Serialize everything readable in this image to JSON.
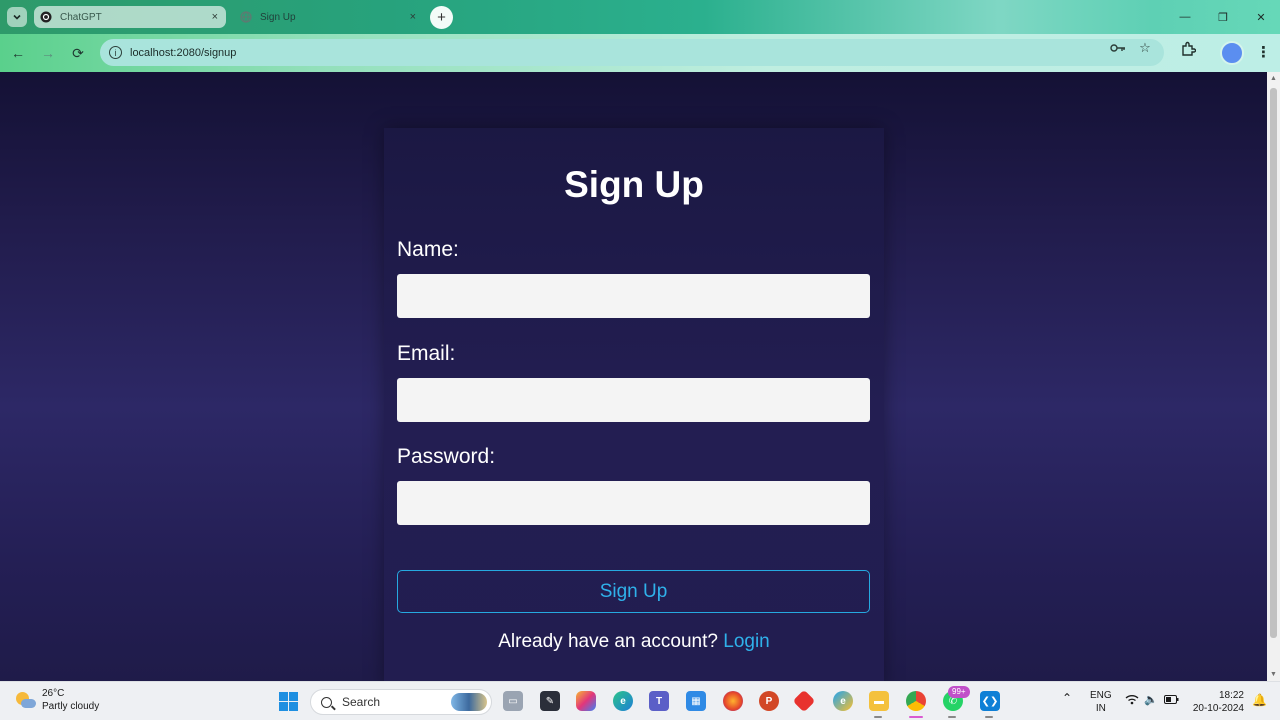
{
  "browser": {
    "tabs": [
      {
        "title": "ChatGPT",
        "close": "×",
        "active": false
      },
      {
        "title": "Sign Up",
        "close": "×",
        "active": true
      }
    ],
    "new_tab": "+",
    "url": "localhost:2080/signup",
    "window_controls": {
      "minimize": "—",
      "maximize": "❐",
      "close": "✕"
    },
    "nav": {
      "back": "←",
      "forward": "→",
      "reload": "⟳"
    }
  },
  "signup": {
    "title": "Sign Up",
    "name_label": "Name:",
    "name_value": "",
    "email_label": "Email:",
    "email_value": "",
    "password_label": "Password:",
    "password_value": "",
    "submit_label": "Sign Up",
    "footer_text": "Already have an account? ",
    "login_link": "Login"
  },
  "taskbar": {
    "weather_temp": "26°C",
    "weather_condition": "Partly cloudy",
    "search_label": "Search",
    "notification_badge": "99+",
    "language_top": "ENG",
    "language_bottom": "IN",
    "time": "18:22",
    "date": "20-10-2024"
  },
  "colors": {
    "accent": "#2fb1ea",
    "page_bg": "#2d2866",
    "card_bg": "#231e52",
    "field_bg": "#f4f4f4"
  }
}
